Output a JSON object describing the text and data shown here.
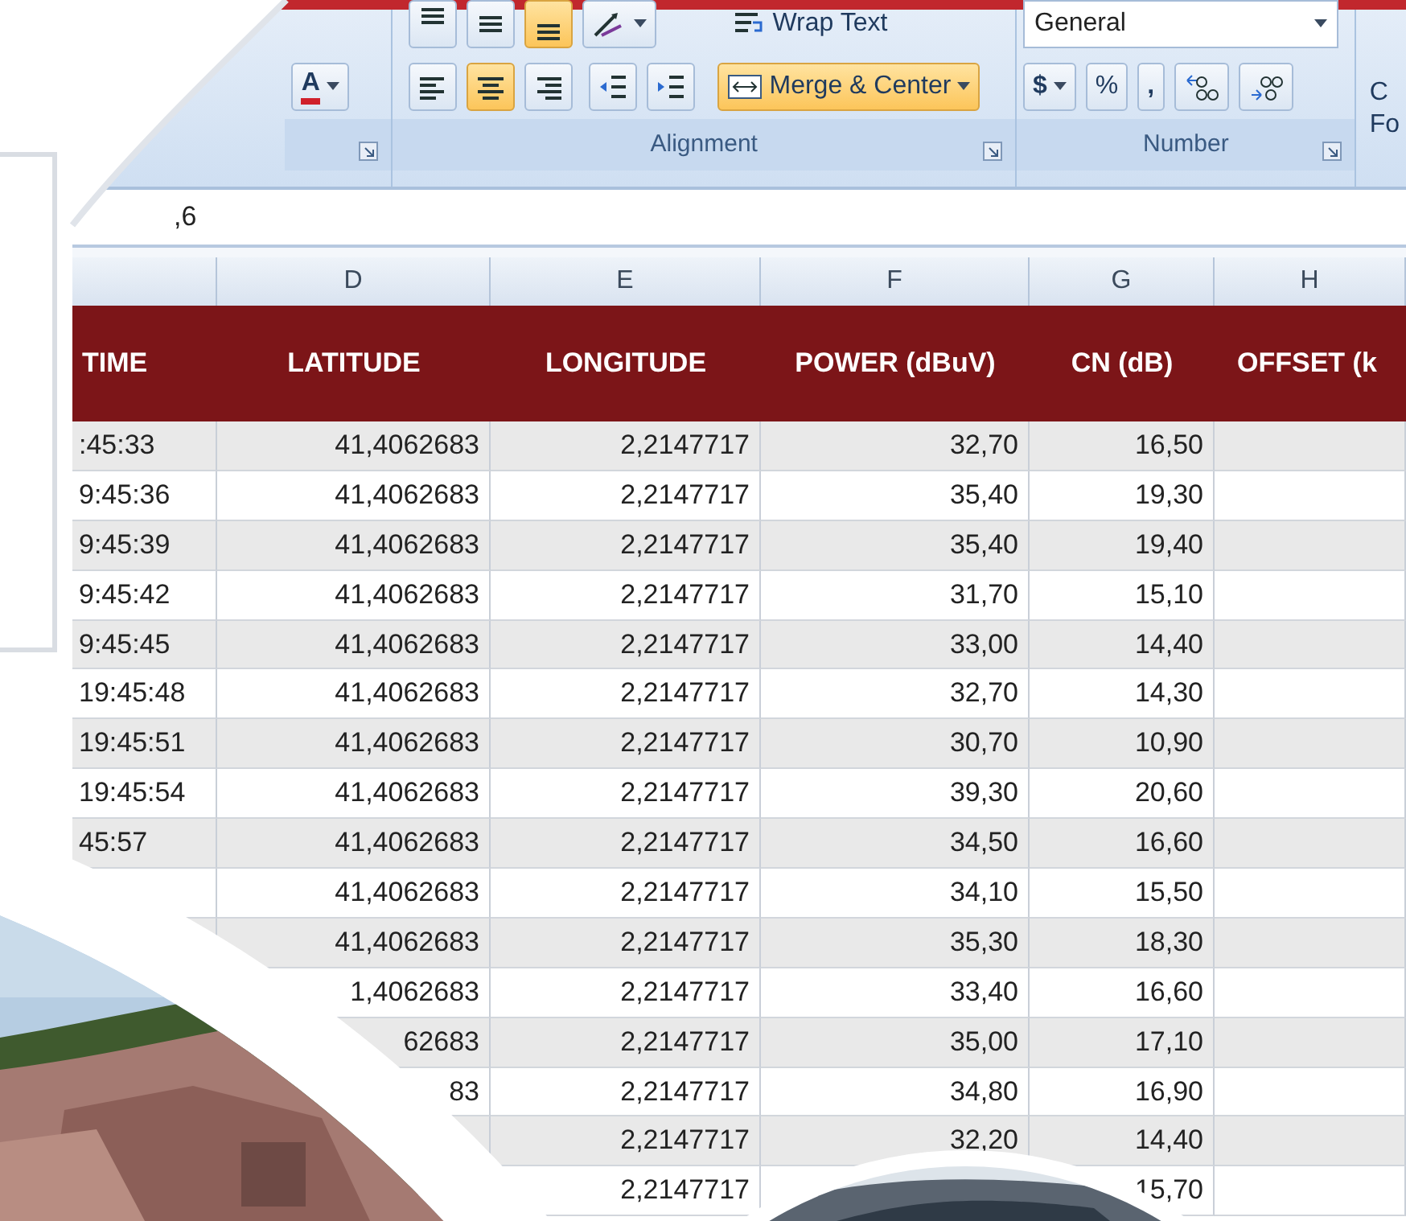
{
  "ribbon": {
    "font_group": {
      "font_color_button": "A"
    },
    "alignment_group": {
      "vertical_align": [
        {
          "kind": "top",
          "selected": false
        },
        {
          "kind": "middle",
          "selected": false
        },
        {
          "kind": "bottom",
          "selected": true
        }
      ],
      "horizontal_align": [
        {
          "kind": "left",
          "selected": false
        },
        {
          "kind": "center",
          "selected": true
        },
        {
          "kind": "right",
          "selected": false
        }
      ],
      "wrap_text_button": "Wrap Text",
      "merge_center_button": {
        "label": "Merge & Center",
        "selected": true
      },
      "label": "Alignment"
    },
    "number_group": {
      "format_dropdown": "General",
      "currency_button": "$",
      "percent_button": "%",
      "comma_button": ",",
      "label": "Number"
    },
    "cut_group": {
      "button_lines": [
        "C",
        "Fo"
      ]
    }
  },
  "formula_bar": {
    "value": ",6"
  },
  "sheet": {
    "column_letters": [
      "D",
      "E",
      "F",
      "G",
      "H"
    ],
    "header": [
      "TIME",
      "LATITUDE",
      "LONGITUDE",
      "POWER (dBuV)",
      "CN (dB)",
      "OFFSET (k"
    ],
    "rows": [
      {
        "time": ":45:33",
        "latitude": "41,4062683",
        "longitude": "2,2147717",
        "power": "32,70",
        "cn": "16,50"
      },
      {
        "time": "9:45:36",
        "latitude": "41,4062683",
        "longitude": "2,2147717",
        "power": "35,40",
        "cn": "19,30"
      },
      {
        "time": "9:45:39",
        "latitude": "41,4062683",
        "longitude": "2,2147717",
        "power": "35,40",
        "cn": "19,40"
      },
      {
        "time": "9:45:42",
        "latitude": "41,4062683",
        "longitude": "2,2147717",
        "power": "31,70",
        "cn": "15,10"
      },
      {
        "time": "9:45:45",
        "latitude": "41,4062683",
        "longitude": "2,2147717",
        "power": "33,00",
        "cn": "14,40"
      },
      {
        "time": "19:45:48",
        "latitude": "41,4062683",
        "longitude": "2,2147717",
        "power": "32,70",
        "cn": "14,30"
      },
      {
        "time": "19:45:51",
        "latitude": "41,4062683",
        "longitude": "2,2147717",
        "power": "30,70",
        "cn": "10,90"
      },
      {
        "time": "19:45:54",
        "latitude": "41,4062683",
        "longitude": "2,2147717",
        "power": "39,30",
        "cn": "20,60"
      },
      {
        "time": "45:57",
        "latitude": "41,4062683",
        "longitude": "2,2147717",
        "power": "34,50",
        "cn": "16,60"
      },
      {
        "latitude": "41,4062683",
        "longitude": "2,2147717",
        "power": "34,10",
        "cn": "15,50"
      },
      {
        "latitude": "41,4062683",
        "longitude": "2,2147717",
        "power": "35,30",
        "cn": "18,30"
      },
      {
        "latitude": "1,4062683",
        "longitude": "2,2147717",
        "power": "33,40",
        "cn": "16,60"
      },
      {
        "latitude": "62683",
        "longitude": "2,2147717",
        "power": "35,00",
        "cn": "17,10"
      },
      {
        "latitude": "83",
        "longitude": "2,2147717",
        "power": "34,80",
        "cn": "16,90"
      },
      {
        "longitude": "2,2147717",
        "power": "32,20",
        "cn": "14,40"
      },
      {
        "longitude": "2,2147717",
        "cn": "15,70"
      }
    ]
  }
}
